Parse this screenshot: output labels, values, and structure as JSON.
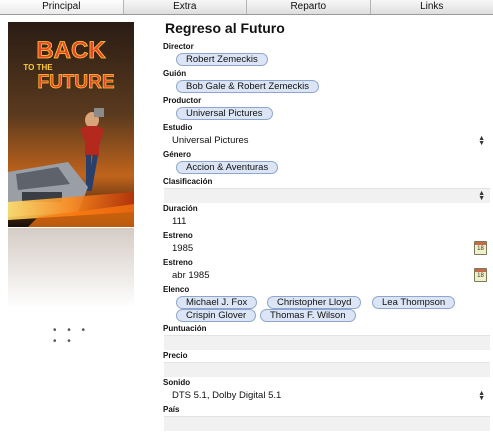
{
  "tabs": [
    "Principal",
    "Extra",
    "Reparto",
    "Links"
  ],
  "poster": {
    "line1": "BACK",
    "line2": "TO THE",
    "line3": "FUTURE"
  },
  "movie": {
    "title": "Regreso al Futuro",
    "director_label": "Director",
    "director": "Robert Zemeckis",
    "guion_label": "Guión",
    "guion": "Bob Gale & Robert Zemeckis",
    "productor_label": "Productor",
    "productor": "Universal Pictures",
    "estudio_label": "Estudio",
    "estudio": "Universal Pictures",
    "genero_label": "Género",
    "genero": "Accion & Aventuras",
    "clasificacion_label": "Clasificación",
    "duracion_label": "Duración",
    "duracion": "111",
    "estreno1_label": "Estreno",
    "estreno1": "1985",
    "estreno2_label": "Estreno",
    "estreno2": "abr 1985",
    "calendar_day": "18",
    "elenco_label": "Elenco",
    "elenco": [
      "Michael J. Fox",
      "Christopher Lloyd",
      "Lea Thompson",
      "Crispin Glover",
      "Thomas F. Wilson"
    ],
    "puntuacion_label": "Puntuación",
    "precio_label": "Precio",
    "sonido_label": "Sonido",
    "sonido": "DTS 5.1, Dolby Digital 5.1",
    "pais_label": "País"
  },
  "pager_dots": "• • • • •",
  "colors": {
    "pill_fill": "#dbe5f5",
    "pill_border": "#8ea6cf",
    "field_bg": "#f1f1f1"
  }
}
